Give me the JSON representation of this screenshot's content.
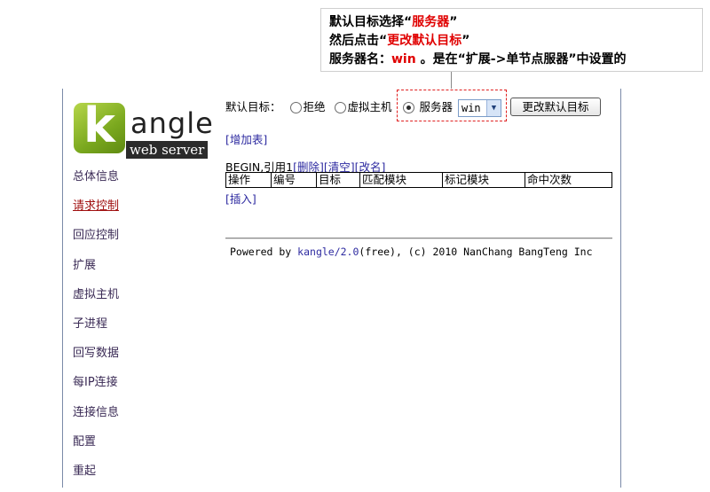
{
  "callout": {
    "line1_prefix": "默认目标选择“",
    "line1_highlight": "服务器",
    "line1_suffix": "”",
    "line2_prefix": "然后点击“",
    "line2_highlight": "更改默认目标",
    "line2_suffix": "”",
    "line3_prefix": "服务器名：",
    "line3_highlight": "win",
    "line3_suffix": " 。是在“扩展->单节点服器”中设置的"
  },
  "logo": {
    "letter": "k",
    "word": "angle",
    "subtitle": "web server"
  },
  "sidebar": {
    "items": [
      {
        "label": "总体信息"
      },
      {
        "label": "请求控制"
      },
      {
        "label": "回应控制"
      },
      {
        "label": "扩展"
      },
      {
        "label": "虚拟主机"
      },
      {
        "label": "子进程"
      },
      {
        "label": "回写数据"
      },
      {
        "label": "每IP连接"
      },
      {
        "label": "连接信息"
      },
      {
        "label": "配置"
      },
      {
        "label": "重起"
      }
    ],
    "active_index": 1
  },
  "target": {
    "label": "默认目标：",
    "options": [
      {
        "label": "拒绝",
        "checked": false
      },
      {
        "label": "虚拟主机",
        "checked": false
      },
      {
        "label": "服务器",
        "checked": true
      }
    ],
    "server_select_value": "win",
    "change_button": "更改默认目标"
  },
  "add_table_link": "[增加表]",
  "table_info": {
    "prefix": "BEGIN,引用1",
    "delete": "[删除]",
    "clear": "[清空]",
    "rename": "[改名]"
  },
  "rules_table": {
    "columns": [
      "操作",
      "编号",
      "目标",
      "匹配模块",
      "标记模块",
      "命中次数"
    ]
  },
  "insert_link": "[插入]",
  "footer": {
    "prefix": "Powered by ",
    "link": "kangle/2.0",
    "suffix": "(free), (c) 2010 NanChang BangTeng Inc"
  },
  "colors": {
    "highlight_red": "#e00000",
    "link_blue": "#2d2aa0",
    "annotation_border": "#e02020"
  }
}
